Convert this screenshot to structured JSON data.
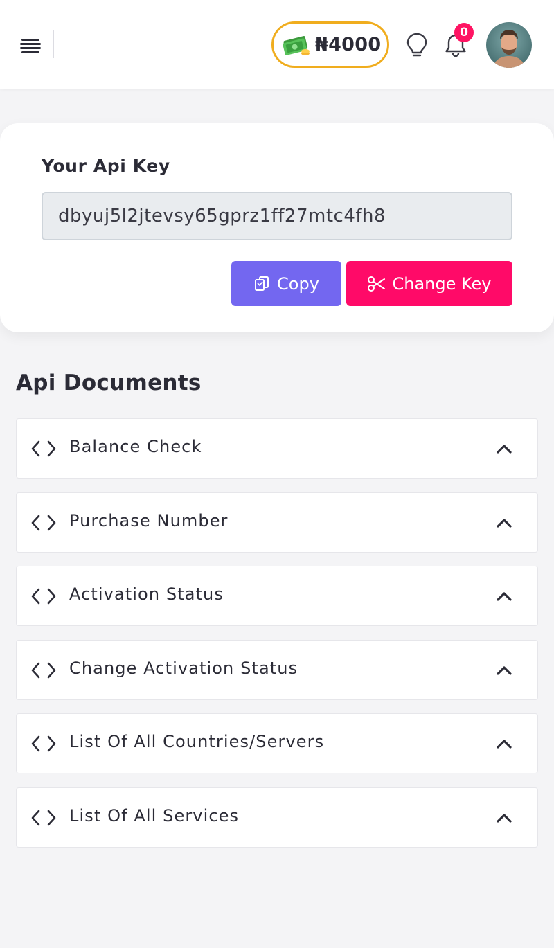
{
  "header": {
    "balance": "₦4000",
    "notifications_count": "0",
    "icons": [
      "menu-icon",
      "money-icon",
      "lightbulb-icon",
      "bell-icon",
      "user-avatar"
    ]
  },
  "api_key_card": {
    "title": "Your Api Key",
    "api_key": "dbyuj5l2jtevsy65gprz1ff27mtc4fh8",
    "copy_label": "Copy",
    "change_label": "Change Key"
  },
  "docs": {
    "title": "Api Documents",
    "items": [
      {
        "label": "Balance Check"
      },
      {
        "label": "Purchase Number"
      },
      {
        "label": "Activation Status"
      },
      {
        "label": "Change Activation Status"
      },
      {
        "label": "List Of All Countries/Servers"
      },
      {
        "label": "List Of All Services"
      }
    ]
  },
  "colors": {
    "primary": "#7367f0",
    "danger": "#ff0a68",
    "balance_border": "#f0ad1e",
    "badge": "#ff1463"
  }
}
